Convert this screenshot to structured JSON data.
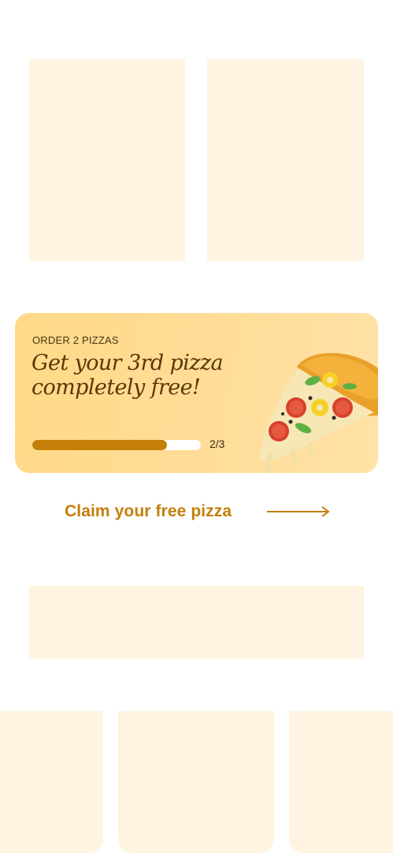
{
  "colors": {
    "placeholder": "#fff4e1",
    "card_background": "#ffdd98",
    "accent": "#c47e0a",
    "headline": "#5c3607"
  },
  "promo": {
    "eyebrow": "ORDER 2 PIZZAS",
    "headline": "Get your 3rd pizza completely free!",
    "progress": {
      "current": 2,
      "total": 3,
      "fraction": 0.8,
      "label": "2/3"
    },
    "image_icon": "pizza-slice-icon"
  },
  "claim": {
    "label": "Claim your free pizza",
    "icon": "arrow-right-icon"
  }
}
